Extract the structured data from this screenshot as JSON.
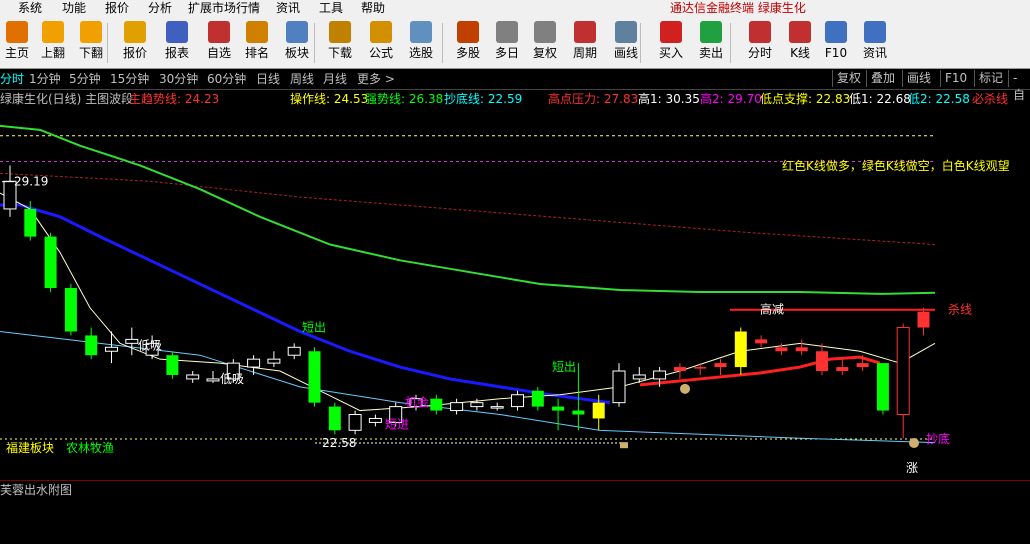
{
  "menu": {
    "items": [
      "系统",
      "功能",
      "报价",
      "分析",
      "扩展市场行情",
      "资讯",
      "工具",
      "帮助"
    ],
    "app_title": "通达信金融终端  绿康生化"
  },
  "toolbar": {
    "buttons": [
      {
        "label": "主页",
        "icon": "home-icon",
        "color": "#e07000"
      },
      {
        "label": "上翻",
        "icon": "arrow-up-icon",
        "color": "#f0a000"
      },
      {
        "label": "下翻",
        "icon": "arrow-down-icon",
        "color": "#f0a000"
      },
      {
        "label": "报价",
        "icon": "quote-yen-icon",
        "color": "#e0a000"
      },
      {
        "label": "报表",
        "icon": "report-icon",
        "color": "#4060c0"
      },
      {
        "label": "自选",
        "icon": "f6-icon",
        "color": "#c03030"
      },
      {
        "label": "排名",
        "icon": "rank-icon",
        "color": "#d08000"
      },
      {
        "label": "板块",
        "icon": "sector-icon",
        "color": "#5080c0"
      },
      {
        "label": "下载",
        "icon": "download-icon",
        "color": "#c08000"
      },
      {
        "label": "公式",
        "icon": "formula-icon",
        "color": "#d09000"
      },
      {
        "label": "选股",
        "icon": "stock-pick-icon",
        "color": "#6090c0"
      },
      {
        "label": "多股",
        "icon": "multi-stock-icon",
        "color": "#c04000"
      },
      {
        "label": "多日",
        "icon": "multi-day-icon",
        "color": "#808080"
      },
      {
        "label": "复权",
        "icon": "adjust-icon",
        "color": "#808080"
      },
      {
        "label": "周期",
        "icon": "f8-icon",
        "color": "#c03030"
      },
      {
        "label": "画线",
        "icon": "draw-line-icon",
        "color": "#6080a0"
      },
      {
        "label": "买入",
        "icon": "buy-icon",
        "color": "#d02020"
      },
      {
        "label": "卖出",
        "icon": "sell-icon",
        "color": "#20a040"
      },
      {
        "label": "分时",
        "icon": "intraday-icon",
        "color": "#c03030"
      },
      {
        "label": "K线",
        "icon": "kline-icon",
        "color": "#c03030"
      },
      {
        "label": "F10",
        "icon": "f10-icon",
        "color": "#4070c0"
      },
      {
        "label": "资讯",
        "icon": "news-icon",
        "color": "#4070c0"
      }
    ]
  },
  "periods": {
    "items": [
      "分时",
      "1分钟",
      "5分钟",
      "15分钟",
      "30分钟",
      "60分钟",
      "日线",
      "周线",
      "月线",
      "更多 >"
    ],
    "active": "分时",
    "right_buttons": [
      "复权",
      "叠加",
      "画线",
      "F10",
      "标记",
      "-自"
    ]
  },
  "indicators": {
    "name": "绿康生化(日线) 主图波段",
    "items": [
      {
        "label": "主趋势线: 24.23",
        "color": "#ff3030"
      },
      {
        "label": "操作线: 24.53",
        "color": "#ffff00"
      },
      {
        "label": "强势线: 26.38",
        "color": "#00ff00"
      },
      {
        "label": "抄底线: 22.59",
        "color": "#00ffff"
      },
      {
        "label": "高点压力: 27.83",
        "color": "#ff3030"
      },
      {
        "label": "高1: 30.35",
        "color": "#ffffff"
      },
      {
        "label": "高2: 29.70",
        "color": "#ff00ff"
      },
      {
        "label": "低点支撑: 22.83",
        "color": "#ffff00"
      },
      {
        "label": "低1: 22.68",
        "color": "#ffffff"
      },
      {
        "label": "低2: 22.58",
        "color": "#00ffff"
      },
      {
        "label": "必杀线",
        "color": "#ff3030"
      }
    ]
  },
  "chart": {
    "note": "红色K线做多，绿色K线做空，白色K线观望",
    "high_label": "29.19",
    "low_label": "22.58",
    "tags": [
      {
        "text": "低吸",
        "color": "#ffffff"
      },
      {
        "text": "低吸",
        "color": "#ffffff"
      },
      {
        "text": "短出",
        "color": "#00ff00"
      },
      {
        "text": "短进",
        "color": "#ff00ff"
      },
      {
        "text": "机会",
        "color": "#ff00ff"
      },
      {
        "text": "短出",
        "color": "#00ff00"
      },
      {
        "text": "高减",
        "color": "#ffffff"
      },
      {
        "text": "杀线",
        "color": "#ff3030"
      },
      {
        "text": "抄底",
        "color": "#ff00ff"
      },
      {
        "text": "涨",
        "color": "#ffffff"
      }
    ],
    "sector_a": "福建板块",
    "sector_b": "农林牧渔"
  },
  "subchart": {
    "title": "芙蓉出水附图"
  },
  "colors": {
    "up": "#ff3232",
    "down": "#00ff00",
    "neutral": "#ffffff",
    "bg": "#000000",
    "ma_blue": "#0000ff",
    "ma_green": "#00ff00",
    "ma_cyan": "#66ccff",
    "ma_yellow": "#ffffcc"
  },
  "chart_data": {
    "type": "candlestick",
    "y_range": [
      22.2,
      30.8
    ],
    "candles": [
      {
        "o": 29.2,
        "h": 29.6,
        "l": 28.3,
        "c": 28.5,
        "k": "w"
      },
      {
        "o": 28.5,
        "h": 28.7,
        "l": 27.7,
        "c": 27.8,
        "k": "g"
      },
      {
        "o": 27.8,
        "h": 27.9,
        "l": 26.4,
        "c": 26.5,
        "k": "g"
      },
      {
        "o": 26.5,
        "h": 26.6,
        "l": 25.3,
        "c": 25.4,
        "k": "g"
      },
      {
        "o": 25.3,
        "h": 25.5,
        "l": 24.7,
        "c": 24.8,
        "k": "g"
      },
      {
        "o": 24.9,
        "h": 25.4,
        "l": 24.6,
        "c": 25.0,
        "k": "w"
      },
      {
        "o": 25.2,
        "h": 25.5,
        "l": 24.8,
        "c": 25.1,
        "k": "w"
      },
      {
        "o": 25.1,
        "h": 25.3,
        "l": 24.7,
        "c": 24.8,
        "k": "w"
      },
      {
        "o": 24.8,
        "h": 24.9,
        "l": 24.2,
        "c": 24.3,
        "k": "g"
      },
      {
        "o": 24.3,
        "h": 24.4,
        "l": 24.1,
        "c": 24.2,
        "k": "w"
      },
      {
        "o": 24.2,
        "h": 24.4,
        "l": 24.1,
        "c": 24.15,
        "k": "w"
      },
      {
        "o": 24.2,
        "h": 24.7,
        "l": 24.1,
        "c": 24.6,
        "k": "w"
      },
      {
        "o": 24.5,
        "h": 24.8,
        "l": 24.3,
        "c": 24.7,
        "k": "w"
      },
      {
        "o": 24.7,
        "h": 24.9,
        "l": 24.5,
        "c": 24.6,
        "k": "w"
      },
      {
        "o": 24.8,
        "h": 25.1,
        "l": 24.7,
        "c": 25.0,
        "k": "w"
      },
      {
        "o": 24.9,
        "h": 25.0,
        "l": 23.5,
        "c": 23.6,
        "k": "g"
      },
      {
        "o": 23.5,
        "h": 23.6,
        "l": 22.8,
        "c": 22.9,
        "k": "g"
      },
      {
        "o": 22.9,
        "h": 23.4,
        "l": 22.8,
        "c": 23.3,
        "k": "w"
      },
      {
        "o": 23.2,
        "h": 23.3,
        "l": 23.0,
        "c": 23.1,
        "k": "w"
      },
      {
        "o": 23.1,
        "h": 23.6,
        "l": 23.0,
        "c": 23.5,
        "k": "w"
      },
      {
        "o": 23.5,
        "h": 23.8,
        "l": 23.4,
        "c": 23.7,
        "k": "w"
      },
      {
        "o": 23.7,
        "h": 23.8,
        "l": 23.3,
        "c": 23.4,
        "k": "g"
      },
      {
        "o": 23.4,
        "h": 23.7,
        "l": 23.3,
        "c": 23.6,
        "k": "w"
      },
      {
        "o": 23.6,
        "h": 23.7,
        "l": 23.4,
        "c": 23.5,
        "k": "w"
      },
      {
        "o": 23.5,
        "h": 23.6,
        "l": 23.4,
        "c": 23.5,
        "k": "w"
      },
      {
        "o": 23.5,
        "h": 23.9,
        "l": 23.4,
        "c": 23.8,
        "k": "w"
      },
      {
        "o": 23.9,
        "h": 24.0,
        "l": 23.4,
        "c": 23.5,
        "k": "g"
      },
      {
        "o": 23.5,
        "h": 23.7,
        "l": 22.9,
        "c": 23.4,
        "k": "g"
      },
      {
        "o": 23.4,
        "h": 24.6,
        "l": 22.9,
        "c": 23.3,
        "k": "g"
      },
      {
        "o": 23.2,
        "h": 23.8,
        "l": 22.9,
        "c": 23.6,
        "k": "y"
      },
      {
        "o": 23.6,
        "h": 24.6,
        "l": 23.5,
        "c": 24.4,
        "k": "w"
      },
      {
        "o": 24.3,
        "h": 24.5,
        "l": 24.1,
        "c": 24.2,
        "k": "w"
      },
      {
        "o": 24.2,
        "h": 24.5,
        "l": 24.0,
        "c": 24.4,
        "k": "w"
      },
      {
        "o": 24.4,
        "h": 24.6,
        "l": 24.2,
        "c": 24.5,
        "k": "r"
      },
      {
        "o": 24.5,
        "h": 24.6,
        "l": 24.3,
        "c": 24.5,
        "k": "r"
      },
      {
        "o": 24.5,
        "h": 24.7,
        "l": 24.3,
        "c": 24.6,
        "k": "r"
      },
      {
        "o": 24.5,
        "h": 25.5,
        "l": 24.3,
        "c": 25.4,
        "k": "y"
      },
      {
        "o": 25.2,
        "h": 25.3,
        "l": 25.0,
        "c": 25.1,
        "k": "r"
      },
      {
        "o": 25.0,
        "h": 25.1,
        "l": 24.8,
        "c": 24.9,
        "k": "r"
      },
      {
        "o": 24.9,
        "h": 25.2,
        "l": 24.8,
        "c": 25.0,
        "k": "r"
      },
      {
        "o": 24.9,
        "h": 25.1,
        "l": 24.3,
        "c": 24.4,
        "k": "r"
      },
      {
        "o": 24.5,
        "h": 24.7,
        "l": 24.3,
        "c": 24.4,
        "k": "r"
      },
      {
        "o": 24.5,
        "h": 24.8,
        "l": 24.4,
        "c": 24.6,
        "k": "r"
      },
      {
        "o": 24.6,
        "h": 24.6,
        "l": 23.3,
        "c": 23.4,
        "k": "g"
      },
      {
        "o": 23.3,
        "h": 25.6,
        "l": 22.7,
        "c": 25.5,
        "k": "r"
      },
      {
        "o": 25.5,
        "h": 26.0,
        "l": 25.3,
        "c": 25.9,
        "k": "r"
      }
    ]
  }
}
